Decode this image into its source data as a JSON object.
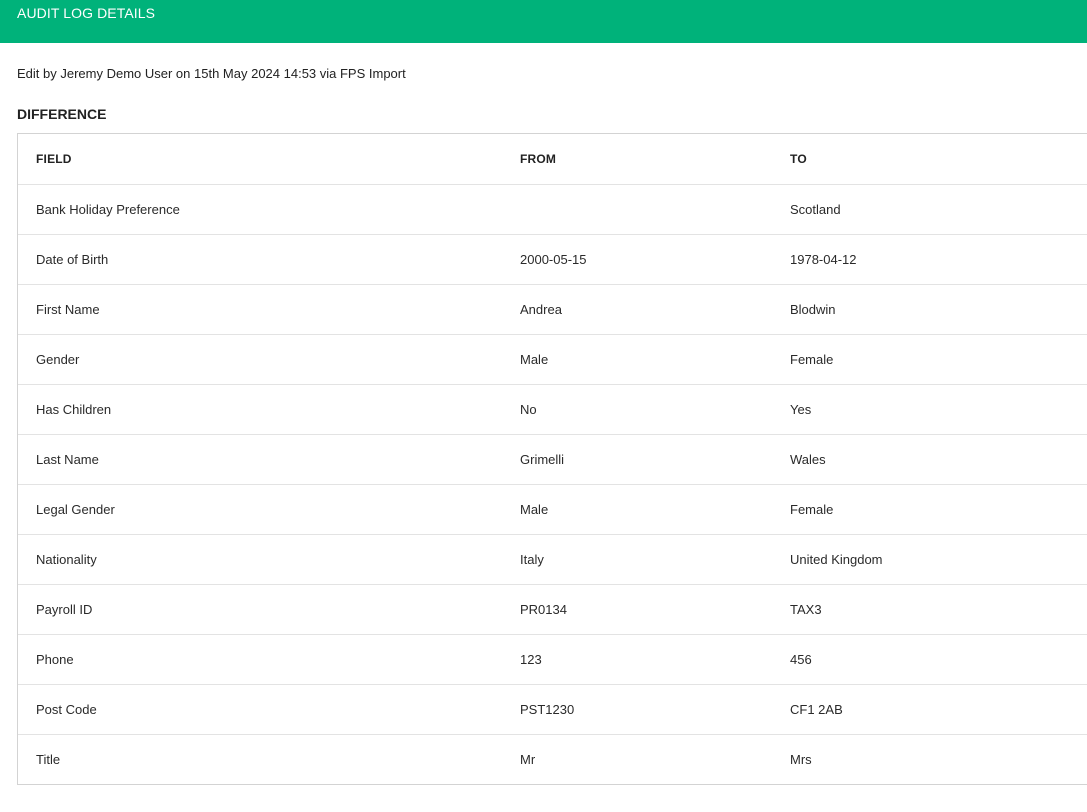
{
  "header": {
    "title": "AUDIT LOG DETAILS",
    "background_color": "#00b27a"
  },
  "summary": "Edit by Jeremy Demo User on 15th May 2024 14:53 via FPS Import",
  "difference": {
    "title": "DIFFERENCE",
    "columns": [
      "FIELD",
      "FROM",
      "TO"
    ],
    "rows": [
      {
        "field": "Bank Holiday Preference",
        "from": "",
        "to": "Scotland"
      },
      {
        "field": "Date of Birth",
        "from": "2000-05-15",
        "to": "1978-04-12"
      },
      {
        "field": "First Name",
        "from": "Andrea",
        "to": "Blodwin"
      },
      {
        "field": "Gender",
        "from": "Male",
        "to": "Female"
      },
      {
        "field": "Has Children",
        "from": "No",
        "to": "Yes"
      },
      {
        "field": "Last Name",
        "from": "Grimelli",
        "to": "Wales"
      },
      {
        "field": "Legal Gender",
        "from": "Male",
        "to": "Female"
      },
      {
        "field": "Nationality",
        "from": "Italy",
        "to": "United Kingdom"
      },
      {
        "field": "Payroll ID",
        "from": "PR0134",
        "to": "TAX3"
      },
      {
        "field": "Phone",
        "from": "123",
        "to": "456"
      },
      {
        "field": "Post Code",
        "from": "PST1230",
        "to": "CF1 2AB"
      },
      {
        "field": "Title",
        "from": "Mr",
        "to": "Mrs"
      }
    ]
  }
}
